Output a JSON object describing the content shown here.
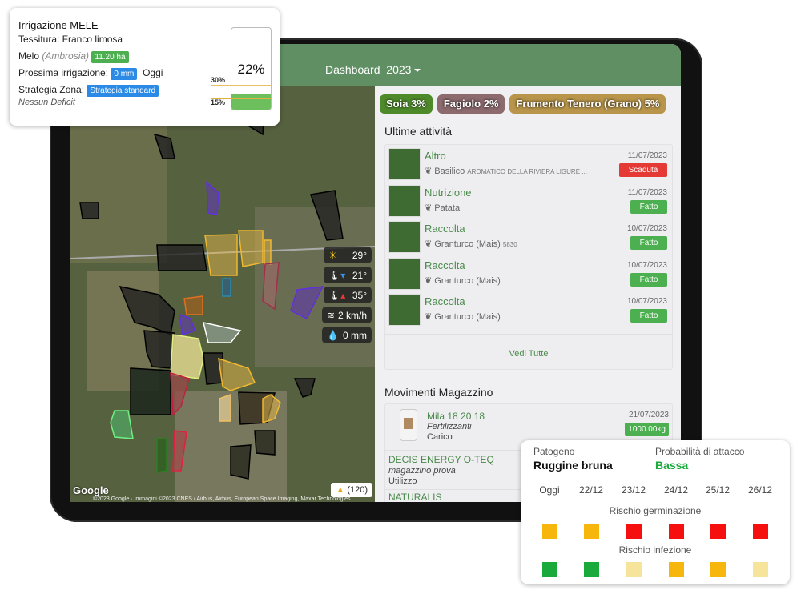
{
  "header": {
    "title": "Dashboard",
    "year": "2023"
  },
  "map": {
    "weather": [
      {
        "icon": "sun-icon",
        "value": "29°"
      },
      {
        "icon": "thermometer-min-icon",
        "value": "21°"
      },
      {
        "icon": "thermometer-max-icon",
        "value": "35°"
      },
      {
        "icon": "wind-icon",
        "value": "2 km/h"
      },
      {
        "icon": "rain-drop-icon",
        "value": "0 mm"
      }
    ],
    "google": "Google",
    "attribution": "©2023 Google · Immagini ©2023 CNES / Airbus, Airbus, European Space Imaging, Maxar Technologies",
    "alert_count": "(120)"
  },
  "crops": [
    {
      "label": "Soia 3%",
      "color": "#4f8a2a"
    },
    {
      "label": "Fagiolo 2%",
      "color": "#8c6a6e"
    },
    {
      "label": "Frumento Tenero (Grano) 5%",
      "color": "#b8954a"
    }
  ],
  "activities": {
    "title": "Ultime attività",
    "items": [
      {
        "type": "Altro",
        "crop": "Basilico",
        "variety": "AROMATICO DELLA RIVIERA LIGURE ...",
        "date": "11/07/2023",
        "status": "Scaduta",
        "status_color": "#e53935"
      },
      {
        "type": "Nutrizione",
        "crop": "Patata",
        "variety": "",
        "date": "11/07/2023",
        "status": "Fatto",
        "status_color": "#4caf50"
      },
      {
        "type": "Raccolta",
        "crop": "Granturco (Mais)",
        "variety": "5830",
        "date": "10/07/2023",
        "status": "Fatto",
        "status_color": "#4caf50"
      },
      {
        "type": "Raccolta",
        "crop": "Granturco (Mais)",
        "variety": "",
        "date": "10/07/2023",
        "status": "Fatto",
        "status_color": "#4caf50"
      },
      {
        "type": "Raccolta",
        "crop": "Granturco (Mais)",
        "variety": "",
        "date": "10/07/2023",
        "status": "Fatto",
        "status_color": "#4caf50"
      }
    ],
    "see_all": "Vedi Tutte"
  },
  "warehouse": {
    "title": "Movimenti Magazzino",
    "items": [
      {
        "name": "Mila 18 20 18",
        "category": "Fertilizzanti",
        "movement": "Carico",
        "date": "21/07/2023",
        "qty": "1000.00kg"
      },
      {
        "name": "DECIS ENERGY O-TEQ",
        "category": "magazzino prova",
        "movement": "Utilizzo"
      },
      {
        "name": "NATURALIS"
      }
    ]
  },
  "irrigation": {
    "title": "Irrigazione MELE",
    "texture": "Tessitura: Franco limosa",
    "crop": "Melo",
    "variety": "(Ambrosia)",
    "area": "11.20 ha",
    "next_label": "Prossima irrigazione:",
    "next_value": "0 mm",
    "next_when": "Oggi",
    "strategy_label": "Strategia Zona:",
    "strategy": "Strategia standard",
    "deficit": "Nessun Deficit",
    "moisture": "22%",
    "moisture_value": 22,
    "upper_threshold": "30%",
    "lower_threshold": "15%"
  },
  "disease": {
    "pathogen_label": "Patogeno",
    "pathogen": "Ruggine bruna",
    "prob_label": "Probabilità di attacco",
    "prob": "Bassa",
    "days": [
      "Oggi",
      "22/12",
      "23/12",
      "24/12",
      "25/12",
      "26/12"
    ],
    "germination_label": "Rischio germinazione",
    "germination": [
      "medium",
      "medium",
      "high",
      "high",
      "high",
      "high"
    ],
    "infection_label": "Rischio infezione",
    "infection": [
      "none",
      "none",
      "low",
      "medium",
      "medium",
      "low"
    ],
    "colors": {
      "none": "#1aaa3c",
      "low": "#f5e49a",
      "medium": "#f6b60c",
      "high": "#f50f0f"
    }
  }
}
